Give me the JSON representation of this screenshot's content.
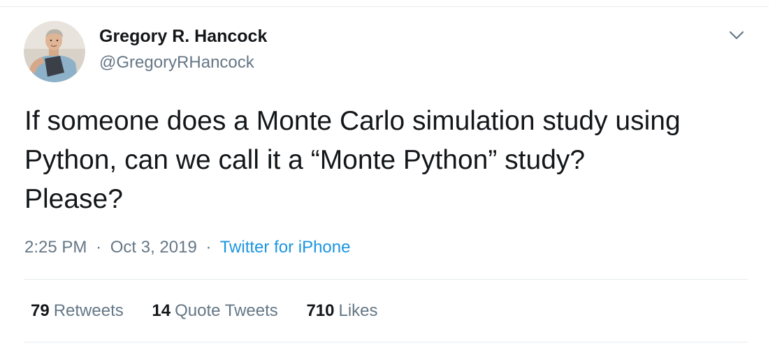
{
  "author": {
    "display_name": "Gregory R. Hancock",
    "handle": "@GregoryRHancock",
    "avatar_icon": "profile-photo"
  },
  "tweet": {
    "lines": [
      "If someone does a Monte Carlo simulation study using",
      "Python, can we call it a “Monte Python” study?",
      "Please?"
    ]
  },
  "meta": {
    "time": "2:25 PM",
    "separator": "·",
    "date": "Oct 3, 2019",
    "source": "Twitter for iPhone"
  },
  "stats": {
    "retweets": {
      "count": "79",
      "label": "Retweets"
    },
    "quote_tweets": {
      "count": "14",
      "label": "Quote Tweets"
    },
    "likes": {
      "count": "710",
      "label": "Likes"
    }
  },
  "colors": {
    "text": "#14171a",
    "secondary": "#657786",
    "link": "#1b95e0",
    "border": "#e6ecf0"
  },
  "icons": {
    "menu": "chevron-down-icon"
  }
}
